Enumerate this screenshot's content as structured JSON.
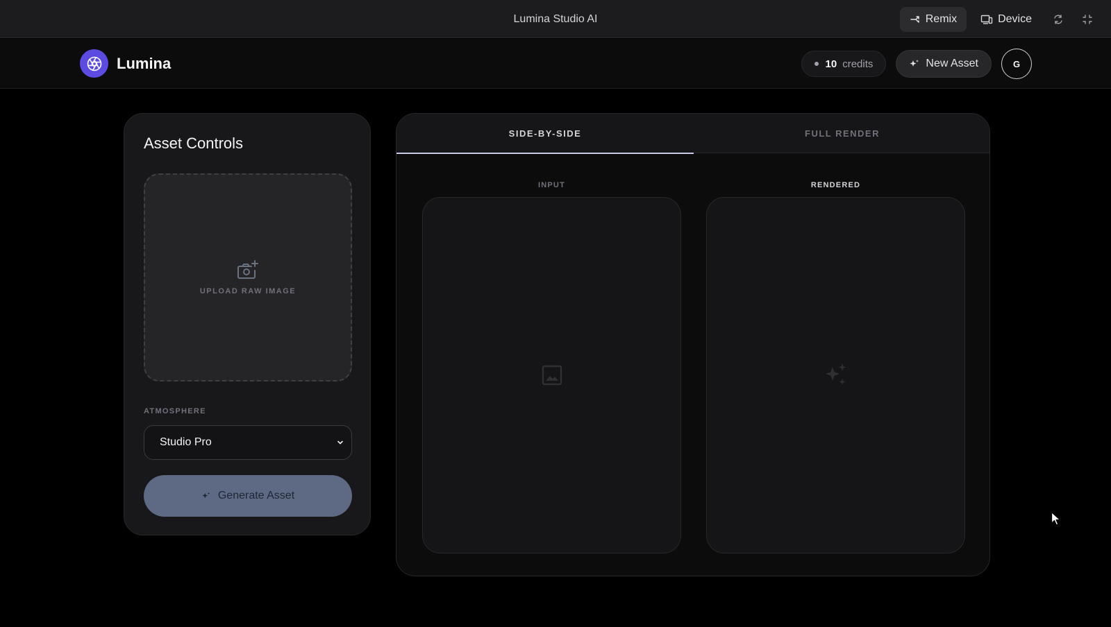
{
  "topbar": {
    "title": "Lumina Studio AI",
    "remix_label": "Remix",
    "device_label": "Device"
  },
  "header": {
    "brand": "Lumina",
    "credits_count": "10",
    "credits_label": "credits",
    "new_asset_label": "New Asset",
    "avatar_initial": "G"
  },
  "controls": {
    "title": "Asset Controls",
    "upload_label": "UPLOAD RAW IMAGE",
    "atmosphere_label": "ATMOSPHERE",
    "atmosphere_value": "Studio Pro",
    "generate_label": "Generate Asset"
  },
  "preview": {
    "tabs": [
      {
        "label": "SIDE-BY-SIDE",
        "active": true
      },
      {
        "label": "FULL RENDER",
        "active": false
      }
    ],
    "input_label": "INPUT",
    "rendered_label": "RENDERED"
  },
  "colors": {
    "brand": "#5b4be0",
    "generate_button": "#5e6a84",
    "active_tab_underline": "#c7c9e8"
  }
}
